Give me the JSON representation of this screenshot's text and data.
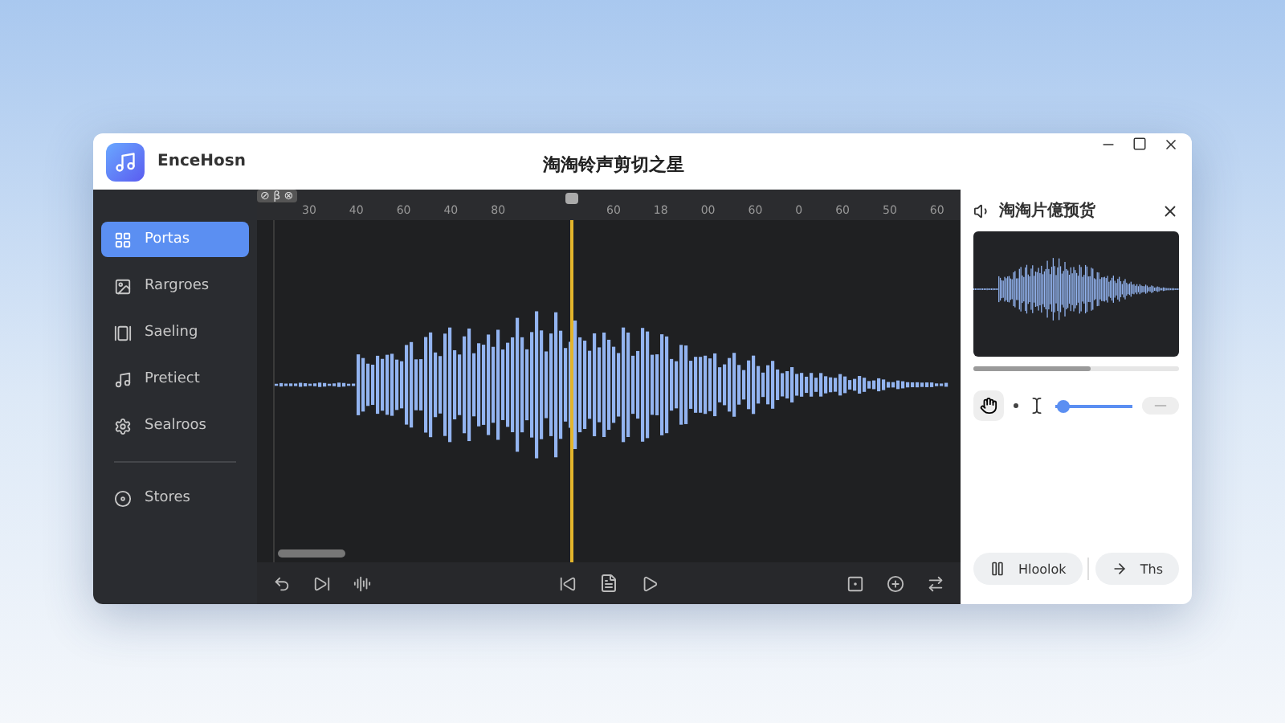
{
  "window": {
    "app_name": "EnceHosn",
    "title": "淘淘铃声剪切之星"
  },
  "sidebar": {
    "items": [
      {
        "label": "Portas",
        "selected": true,
        "kind": "grid"
      },
      {
        "label": "Rargroes",
        "selected": false,
        "kind": "image"
      },
      {
        "label": "Saeling",
        "selected": false,
        "kind": "gallery"
      },
      {
        "label": "Pretiect",
        "selected": false,
        "kind": "music"
      },
      {
        "label": "Sealroos",
        "selected": false,
        "kind": "gear"
      }
    ],
    "footer_item": {
      "label": "Stores",
      "selected": false
    }
  },
  "editor": {
    "ruler_badge": "⊘ β ⊗",
    "ticks": [
      "30",
      "40",
      "60",
      "40",
      "80",
      "60",
      "18",
      "00",
      "60",
      "0",
      "60",
      "50",
      "60"
    ],
    "playhead": {
      "level": 0.43
    }
  },
  "preview": {
    "title": "淘淘片億预货",
    "progress": {
      "level": 0.57
    },
    "volume": {
      "level": 0.1
    }
  },
  "actions": [
    {
      "label": "Hloolok",
      "kind": "pause"
    },
    {
      "label": "Ths",
      "kind": "forward"
    }
  ]
}
